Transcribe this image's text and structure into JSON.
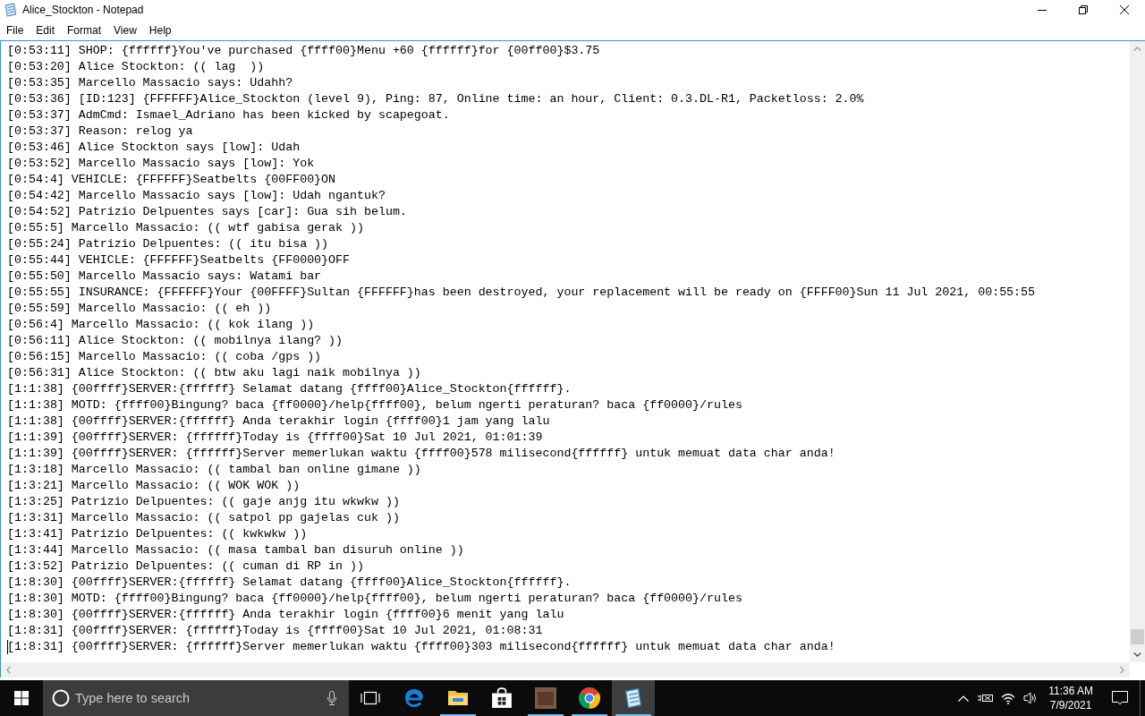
{
  "window": {
    "title": "Alice_Stockton - Notepad"
  },
  "menu": [
    "File",
    "Edit",
    "Format",
    "View",
    "Help"
  ],
  "lines": [
    {
      "text": "[0:53:11] SHOP: {ffffff}You've purchased {ffff00}Menu +60 {ffffff}for {00ff00}$3.75",
      "caret": false
    },
    {
      "text": "[0:53:20] Alice Stockton: (( lag  ))",
      "caret": false
    },
    {
      "text": "[0:53:35] Marcello Massacio says: Udahh?",
      "caret": false
    },
    {
      "text": "[0:53:36] [ID:123] {FFFFFF}Alice_Stockton (level 9), Ping: 87, Online time: an hour, Client: 0.3.DL-R1, Packetloss: 2.0%",
      "caret": false
    },
    {
      "text": "[0:53:37] AdmCmd: Ismael_Adriano has been kicked by scapegoat.",
      "caret": false
    },
    {
      "text": "[0:53:37] Reason: relog ya",
      "caret": false
    },
    {
      "text": "[0:53:46] Alice Stockton says [low]: Udah",
      "caret": false
    },
    {
      "text": "[0:53:52] Marcello Massacio says [low]: Yok",
      "caret": false
    },
    {
      "text": "[0:54:4] VEHICLE: {FFFFFF}Seatbelts {00FF00}ON",
      "caret": false
    },
    {
      "text": "[0:54:42] Marcello Massacio says [low]: Udah ngantuk?",
      "caret": false
    },
    {
      "text": "[0:54:52] Patrizio Delpuentes says [car]: Gua sih belum.",
      "caret": false
    },
    {
      "text": "[0:55:5] Marcello Massacio: (( wtf gabisa gerak ))",
      "caret": false
    },
    {
      "text": "[0:55:24] Patrizio Delpuentes: (( itu bisa ))",
      "caret": false
    },
    {
      "text": "[0:55:44] VEHICLE: {FFFFFF}Seatbelts {FF0000}OFF",
      "caret": false
    },
    {
      "text": "[0:55:50] Marcello Massacio says: Watami bar",
      "caret": false
    },
    {
      "text": "[0:55:55] INSURANCE: {FFFFFF}Your {00FFFF}Sultan {FFFFFF}has been destroyed, your replacement will be ready on {FFFF00}Sun 11 Jul 2021, 00:55:55",
      "caret": false
    },
    {
      "text": "[0:55:59] Marcello Massacio: (( eh ))",
      "caret": false
    },
    {
      "text": "[0:56:4] Marcello Massacio: (( kok ilang ))",
      "caret": false
    },
    {
      "text": "[0:56:11] Alice Stockton: (( mobilnya ilang? ))",
      "caret": false
    },
    {
      "text": "[0:56:15] Marcello Massacio: (( coba /gps ))",
      "caret": false
    },
    {
      "text": "[0:56:31] Alice Stockton: (( btw aku lagi naik mobilnya ))",
      "caret": false
    },
    {
      "text": "[1:1:38] {00ffff}SERVER:{ffffff} Selamat datang {ffff00}Alice_Stockton{ffffff}.",
      "caret": false
    },
    {
      "text": "[1:1:38] MOTD: {ffff00}Bingung? baca {ff0000}/help{ffff00}, belum ngerti peraturan? baca {ff0000}/rules",
      "caret": false
    },
    {
      "text": "[1:1:38] {00ffff}SERVER:{ffffff} Anda terakhir login {ffff00}1 jam yang lalu",
      "caret": false
    },
    {
      "text": "[1:1:39] {00ffff}SERVER: {ffffff}Today is {ffff00}Sat 10 Jul 2021, 01:01:39",
      "caret": false
    },
    {
      "text": "[1:1:39] {00ffff}SERVER: {ffffff}Server memerlukan waktu {ffff00}578 milisecond{ffffff} untuk memuat data char anda!",
      "caret": false
    },
    {
      "text": "[1:3:18] Marcello Massacio: (( tambal ban online gimane ))",
      "caret": false
    },
    {
      "text": "[1:3:21] Marcello Massacio: (( WOK WOK ))",
      "caret": false
    },
    {
      "text": "[1:3:25] Patrizio Delpuentes: (( gaje anjg itu wkwkw ))",
      "caret": false
    },
    {
      "text": "[1:3:31] Marcello Massacio: (( satpol pp gajelas cuk ))",
      "caret": false
    },
    {
      "text": "[1:3:41] Patrizio Delpuentes: (( kwkwkw ))",
      "caret": false
    },
    {
      "text": "[1:3:44] Marcello Massacio: (( masa tambal ban disuruh online ))",
      "caret": false
    },
    {
      "text": "[1:3:52] Patrizio Delpuentes: (( cuman di RP in ))",
      "caret": false
    },
    {
      "text": "[1:8:30] {00ffff}SERVER:{ffffff} Selamat datang {ffff00}Alice_Stockton{ffffff}.",
      "caret": false
    },
    {
      "text": "[1:8:30] MOTD: {ffff00}Bingung? baca {ff0000}/help{ffff00}, belum ngerti peraturan? baca {ff0000}/rules",
      "caret": false
    },
    {
      "text": "[1:8:30] {00ffff}SERVER:{ffffff} Anda terakhir login {ffff00}6 menit yang lalu",
      "caret": false
    },
    {
      "text": "[1:8:31] {00ffff}SERVER: {ffffff}Today is {ffff00}Sat 10 Jul 2021, 01:08:31",
      "caret": false
    },
    {
      "text": "[1:8:31] {00ffff}SERVER: {ffffff}Server memerlukan waktu {ffff00}303 milisecond{ffffff} untuk memuat data char anda!",
      "caret": true
    }
  ],
  "taskbar": {
    "search": {
      "placeholder": "Type here to search"
    },
    "apps": [
      {
        "kind": "browser",
        "running": false,
        "selected": false
      },
      {
        "kind": "folder",
        "running": true,
        "selected": false
      },
      {
        "kind": "store",
        "running": false,
        "selected": false
      },
      {
        "kind": "picture",
        "running": true,
        "selected": false
      },
      {
        "kind": "chrome",
        "running": true,
        "selected": false
      },
      {
        "kind": "notepad",
        "running": true,
        "selected": true
      }
    ],
    "clock": {
      "time": "11:36 AM",
      "date": "7/9/2021"
    }
  }
}
